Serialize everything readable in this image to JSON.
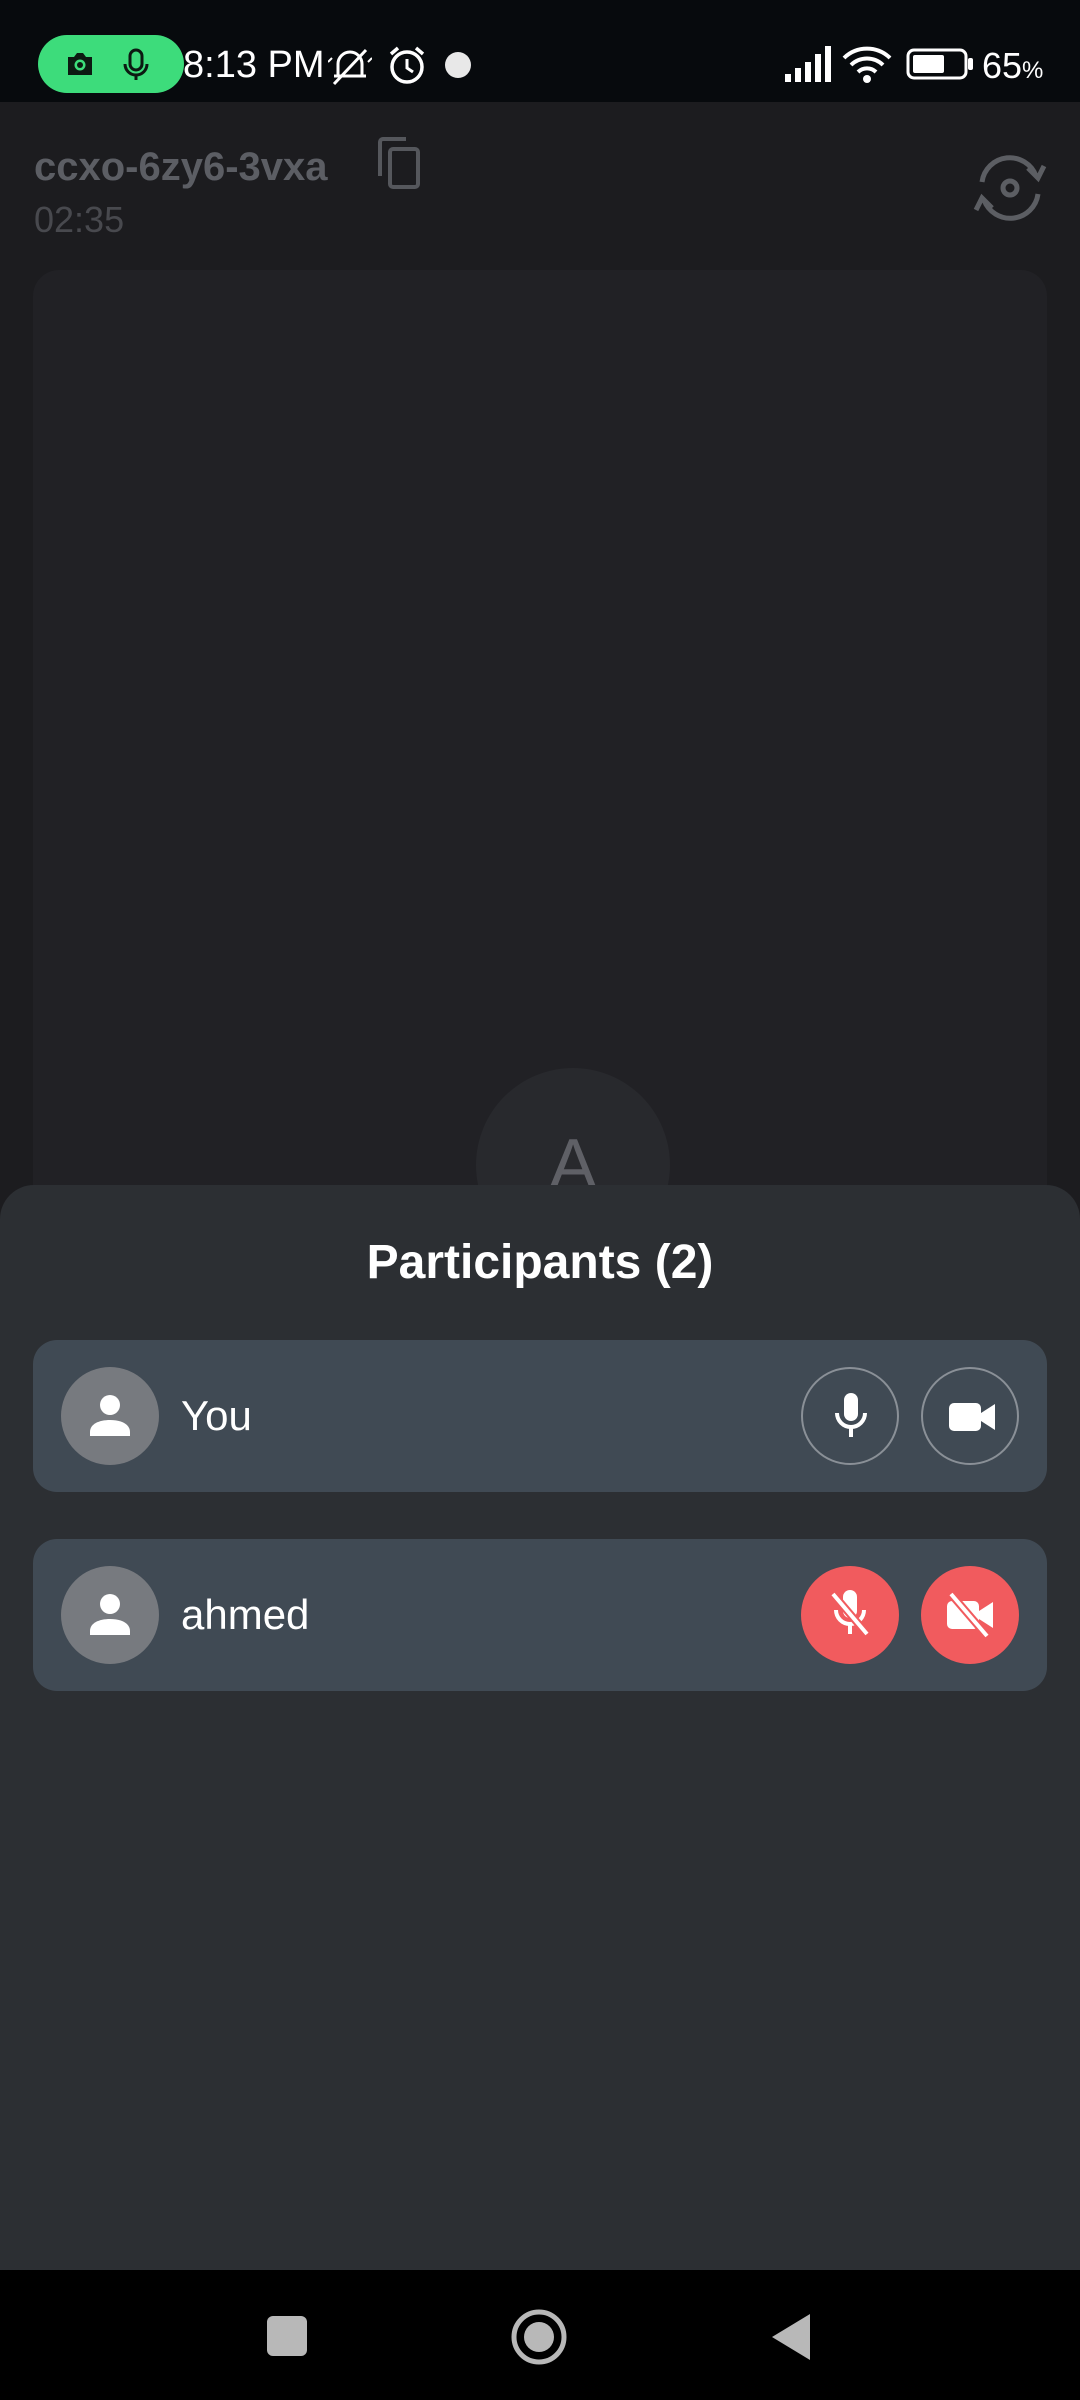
{
  "status_bar": {
    "time": "8:13 PM",
    "battery_percent": "65",
    "battery_unit": "%",
    "battery_level": 0.65,
    "icons": [
      "camera-icon",
      "mic-icon",
      "bell-off-icon",
      "alarm-icon",
      "dot-icon",
      "signal-icon",
      "wifi-icon",
      "battery-icon"
    ]
  },
  "meeting": {
    "code": "ccxo-6zy6-3vxa",
    "timer": "02:35",
    "remote_avatar_initial": "A"
  },
  "participants_sheet": {
    "title": "Participants (2)",
    "participants": [
      {
        "name": "You",
        "mic": "on",
        "camera": "on"
      },
      {
        "name": "ahmed",
        "mic": "off",
        "camera": "off"
      }
    ]
  },
  "colors": {
    "recording_pill": "#3ddc7b",
    "sheet_bg": "#2c2f33",
    "row_bg": "#404a54",
    "muted_red": "#f15b5e"
  },
  "nav_bar": {
    "icons": [
      "recents-square-icon",
      "home-circle-icon",
      "back-triangle-icon"
    ]
  }
}
